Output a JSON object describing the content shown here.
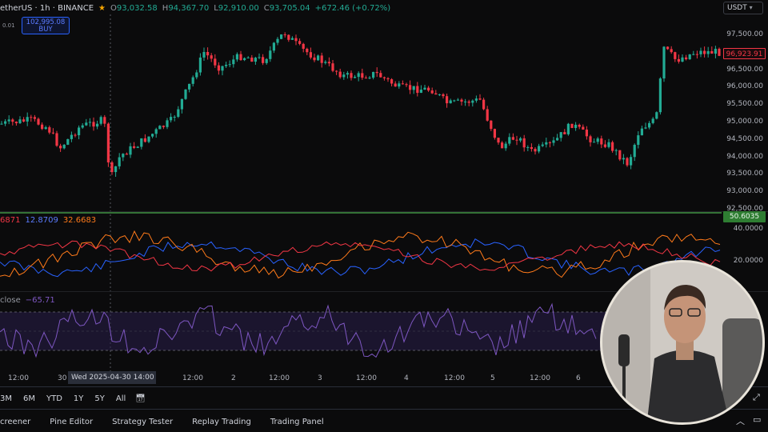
{
  "header": {
    "symbol": "etherUS · 1h · BINANCE",
    "open_label": "O",
    "open": "93,032.58",
    "high_label": "H",
    "high": "94,367.70",
    "low_label": "L",
    "low": "92,910.00",
    "close_label": "C",
    "close": "93,705.04",
    "change": "+672.46 (+0.72%)"
  },
  "top_left_value": "0.01",
  "buy_box": {
    "price": "102,995.08",
    "label": "BUY"
  },
  "currency": "USDT",
  "y_axis_labels": [
    "97,500.00",
    "97,000.00",
    "96,500.00",
    "96,000.00",
    "95,500.00",
    "95,000.00",
    "94,500.00",
    "94,000.00",
    "93,500.00",
    "93,000.00",
    "92,500.00"
  ],
  "current_price_tag": "96,923.91",
  "indicator_tag": "50.6035",
  "dmi": {
    "v1": "6871",
    "v2": "12.8709",
    "v3": "32.6683",
    "axis": [
      "40.0000",
      "20.0000"
    ],
    "colors": {
      "v1": "#f23645",
      "v2": "#2962ff",
      "v3": "#ff7a1a"
    }
  },
  "osc": {
    "label": "close",
    "value": "−65.71"
  },
  "x_axis_labels": [
    "12:00",
    "30",
    "12:00",
    "2",
    "12:00",
    "3",
    "12:00",
    "4",
    "12:00",
    "5",
    "12:00",
    "6"
  ],
  "x_cursor_label": "Wed 2025-04-30   14:00",
  "ranges": [
    "3M",
    "6M",
    "YTD",
    "1Y",
    "5Y",
    "All"
  ],
  "bottom_tabs": [
    "creener",
    "Pine Editor",
    "Strategy Tester",
    "Replay Trading",
    "Trading Panel"
  ],
  "colors": {
    "up": "#22ab94",
    "down": "#f23645",
    "accent": "#2962ff",
    "green_line": "#4caf50",
    "osc_line": "#7e57c2"
  },
  "icons": [
    "star-icon",
    "calendar-icon",
    "expand-icon",
    "chevron-up-icon",
    "settings-icon"
  ]
}
